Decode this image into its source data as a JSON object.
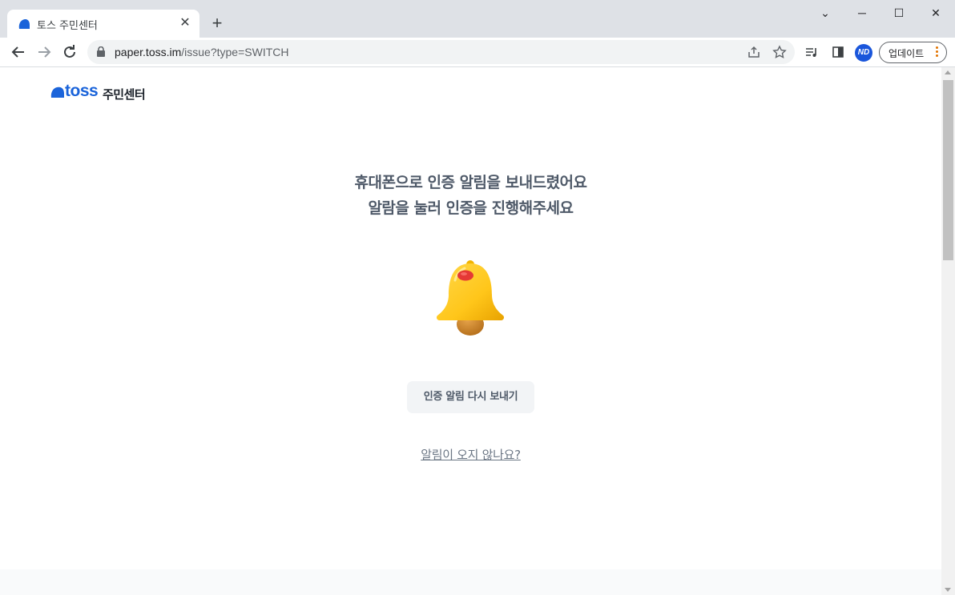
{
  "browser": {
    "tab_title": "토스 주민센터",
    "tab_close": "✕",
    "new_tab": "+",
    "url_host": "paper.toss.im",
    "url_path": "/issue?type=SWITCH",
    "profile_initials": "ND",
    "update_label": "업데이트",
    "window_minimize": "─",
    "window_maximize": "☐",
    "window_close": "✕",
    "tab_search": "⌄"
  },
  "page": {
    "logo_text": "toss",
    "logo_sub": "주민센터",
    "headline_line1": "휴대폰으로 인증 알림을 보내드렸어요",
    "headline_line2": "알람을 눌러 인증을 진행해주세요",
    "resend_label": "인증 알림 다시 보내기",
    "help_link": "알림이 오지 않나요?"
  },
  "colors": {
    "brand": "#1b64da",
    "headline": "#4e5968",
    "button_bg": "#f2f4f6",
    "bell_yellow": "#ffc61a",
    "bell_red": "#e53935"
  }
}
